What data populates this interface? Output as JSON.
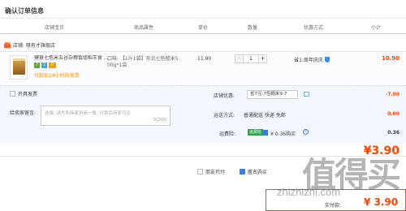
{
  "page": {
    "title": "确认订单信息"
  },
  "columns": [
    "店铺宝贝",
    "商品属性",
    "单价",
    "数量",
    "优惠方式",
    "小计"
  ],
  "shop": {
    "label": "店铺: 够有才旗舰店"
  },
  "item": {
    "name": "健泉七色米五谷杂粮饭组稻王食 ...",
    "badges": [
      "7",
      "X",
      "P"
    ],
    "promo": "付款后24小时内发货",
    "attr_line1": "口味: 【1斤1袋】东北七色糙米5",
    "attr_line2": "00g*1袋",
    "price": "11.90",
    "quantity": "1",
    "benefit": "省1:周年庆庆",
    "subtotal": "10.90"
  },
  "invoice": {
    "label": "开具发票"
  },
  "message": {
    "label": "给卖家留言:",
    "placeholder": "选填, 请先和商家协商一致, 付款后商家可见",
    "count": "0/200"
  },
  "coupon": {
    "label": "店铺优惠:",
    "selected": "省7元:7色糙米9-7",
    "amount": "-7.00"
  },
  "shipping": {
    "label": "运送方式:",
    "value": "普通配送 快递 免邮",
    "amount": "0.00"
  },
  "insurance": {
    "label": "运费险:",
    "badge": "运费险",
    "value": "¥ 0.36购买",
    "amount": "0.36"
  },
  "total": {
    "amount": "¥3.90"
  },
  "bottom_options": [
    {
      "label": "朋友代付",
      "checked": false
    },
    {
      "label": "匿名购买",
      "checked": true
    }
  ],
  "pay": {
    "label": "实付款:",
    "amount": "¥ 3.90"
  },
  "watermark": {
    "big": "值得买",
    "url": "zhizhizhi.com"
  }
}
